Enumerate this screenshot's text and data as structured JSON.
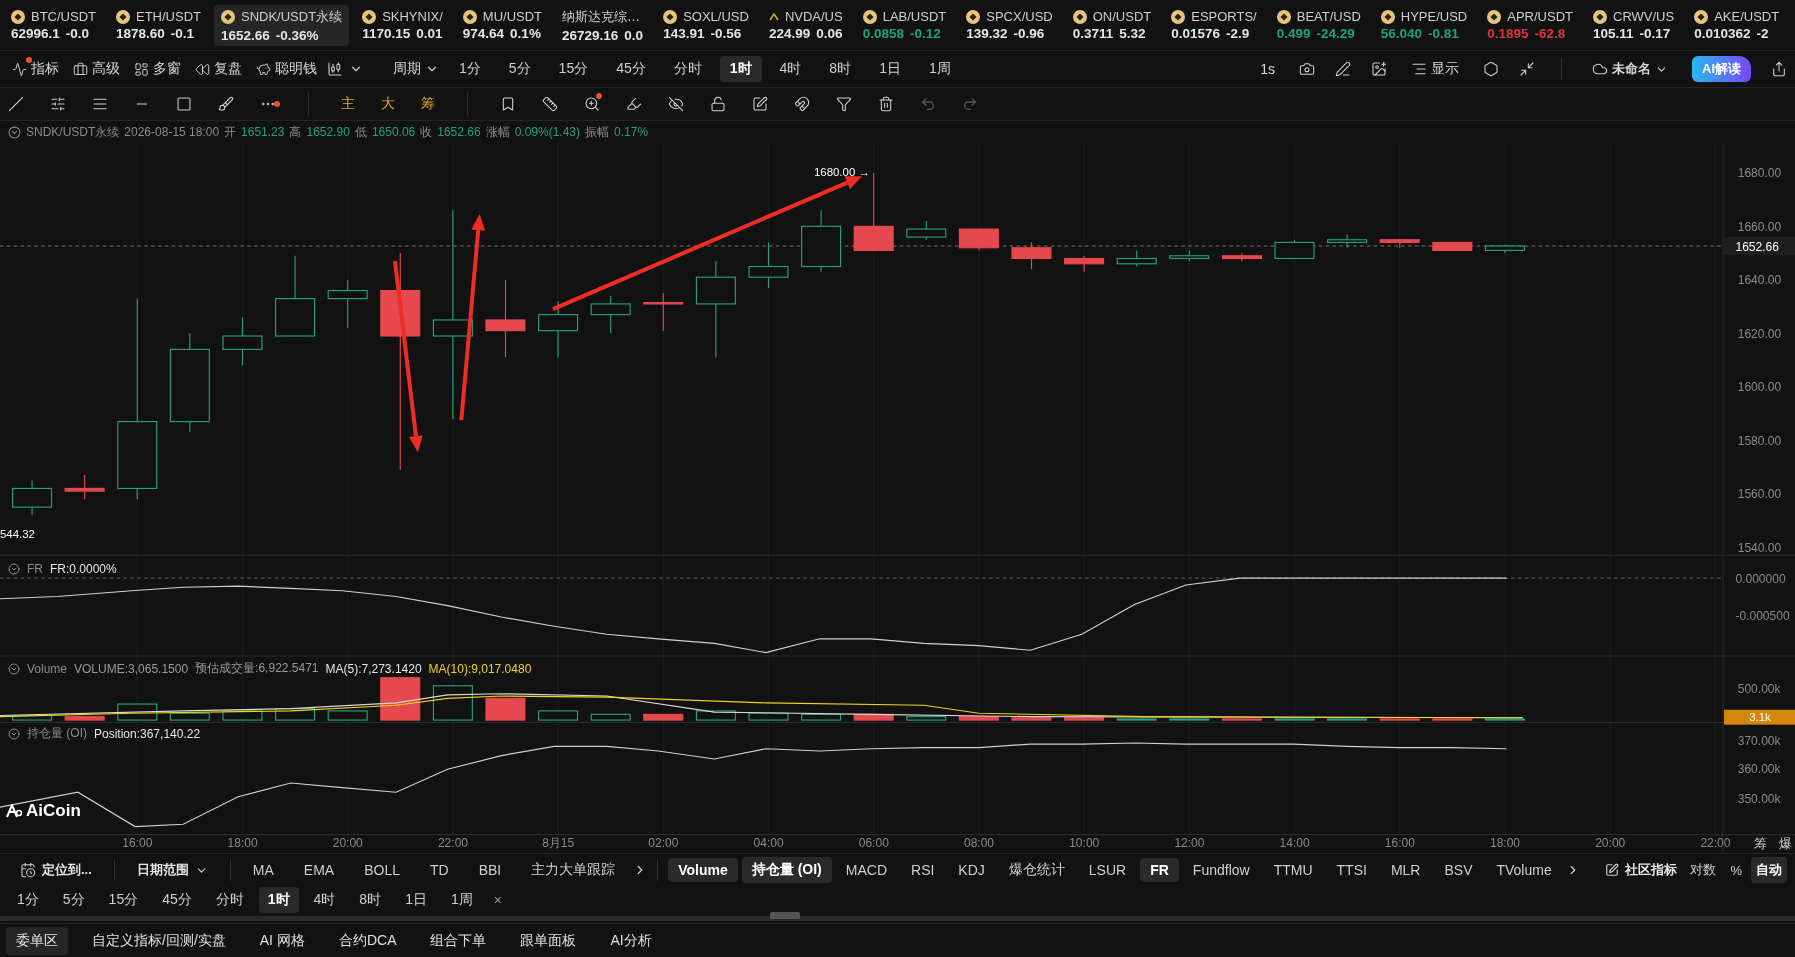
{
  "tickers": [
    {
      "kind": "coin",
      "symbol": "BTC/USDT",
      "price": "62996.1",
      "change": "-0.0",
      "color": "#e6e6e6",
      "selected": false
    },
    {
      "kind": "coin",
      "symbol": "ETH/USDT",
      "price": "1878.60",
      "change": "-0.1",
      "color": "#e6e6e6",
      "selected": false
    },
    {
      "kind": "coin",
      "symbol": "SNDK/USDT永续",
      "price": "1652.66",
      "change": "-0.36%",
      "color": "#e6e6e6",
      "selected": true
    },
    {
      "kind": "coin",
      "symbol": "SKHYNIX/",
      "price": "1170.15",
      "change": "0.01",
      "color": "#e6e6e6",
      "selected": false
    },
    {
      "kind": "coin",
      "symbol": "MU/USDT",
      "price": "974.64",
      "change": "0.1%",
      "color": "#e6e6e6",
      "selected": false
    },
    {
      "kind": "none",
      "symbol": "纳斯达克综…",
      "price": "26729.16",
      "change": "0.0",
      "color": "#e6e6e6",
      "selected": false
    },
    {
      "kind": "coin",
      "symbol": "SOXL/USD",
      "price": "143.91",
      "change": "-0.56",
      "color": "#e6e6e6",
      "selected": false
    },
    {
      "kind": "mark",
      "symbol": "NVDA/US",
      "price": "224.99",
      "change": "0.06",
      "color": "#e6e6e6",
      "selected": false
    },
    {
      "kind": "coin",
      "symbol": "LAB/USDT",
      "price": "0.0858",
      "change": "-0.12",
      "color": "#1fa37a",
      "selected": false
    },
    {
      "kind": "coin",
      "symbol": "SPCX/USD",
      "price": "139.32",
      "change": "-0.96",
      "color": "#e6e6e6",
      "selected": false
    },
    {
      "kind": "coin",
      "symbol": "ON/USDT",
      "price": "0.3711",
      "change": "5.32",
      "color": "#e6e6e6",
      "selected": false
    },
    {
      "kind": "coin",
      "symbol": "ESPORTS/",
      "price": "0.01576",
      "change": "-2.9",
      "color": "#e6e6e6",
      "selected": false
    },
    {
      "kind": "coin",
      "symbol": "BEAT/USD",
      "price": "0.499",
      "change": "-24.29",
      "color": "#1fa37a",
      "selected": false
    },
    {
      "kind": "coin",
      "symbol": "HYPE/USD",
      "price": "56.040",
      "change": "-0.81",
      "color": "#1fa37a",
      "selected": false
    },
    {
      "kind": "coin",
      "symbol": "APR/USDT",
      "price": "0.1895",
      "change": "-62.8",
      "color": "#d8373d",
      "selected": false
    },
    {
      "kind": "coin",
      "symbol": "CRWV/US",
      "price": "105.11",
      "change": "-0.17",
      "color": "#e6e6e6",
      "selected": false
    },
    {
      "kind": "coin",
      "symbol": "AKE/USDT",
      "price": "0.010362",
      "change": "-2",
      "color": "#e6e6e6",
      "selected": false
    }
  ],
  "toolbar": {
    "tools": [
      {
        "kind": "indicator",
        "label": "指标",
        "notify": true
      },
      {
        "kind": "advanced",
        "label": "高级",
        "notify": false
      },
      {
        "kind": "windows",
        "label": "多窗",
        "notify": false
      },
      {
        "kind": "replay",
        "label": "复盘",
        "notify": false
      },
      {
        "kind": "smart",
        "label": "聪明钱",
        "notify": false
      }
    ],
    "period_menu": "周期",
    "periods": [
      {
        "label": "1分",
        "selected": false
      },
      {
        "label": "5分",
        "selected": false
      },
      {
        "label": "15分",
        "selected": false
      },
      {
        "label": "45分",
        "selected": false
      },
      {
        "label": "分时",
        "selected": false
      },
      {
        "label": "1时",
        "selected": true
      },
      {
        "label": "4时",
        "selected": false
      },
      {
        "label": "8时",
        "selected": false
      },
      {
        "label": "1日",
        "selected": false
      },
      {
        "label": "1周",
        "selected": false
      }
    ],
    "refresh": "1s",
    "display": "显示",
    "layout": "未命名",
    "ai": "AI解读"
  },
  "drawing_toolbar": {
    "more_notify": true,
    "zoom_notify": true,
    "layers": [
      "主",
      "大",
      "筹"
    ]
  },
  "info": {
    "symbol": "SNDK/USDT永续",
    "time": "2026-08-15 18:00",
    "fields": [
      {
        "label": "开",
        "value": "1651.23"
      },
      {
        "label": "高",
        "value": "1652.90"
      },
      {
        "label": "低",
        "value": "1650.06"
      },
      {
        "label": "收",
        "value": "1652.66"
      },
      {
        "label": "涨幅",
        "value": "0.09%(1.43)"
      },
      {
        "label": "振幅",
        "value": "0.17%"
      }
    ]
  },
  "chart": {
    "price_ticks": [
      "1680.00",
      "1660.00",
      "1640.00",
      "1620.00",
      "1600.00",
      "1580.00",
      "1560.00",
      "1540.00"
    ],
    "last_price": "1652.66",
    "high_marker": "1680.00 →",
    "low_marker": "544.32",
    "time_ticks": [
      "16:00",
      "18:00",
      "20:00",
      "22:00",
      "8月15",
      "02:00",
      "04:00",
      "06:00",
      "08:00",
      "10:00",
      "12:00",
      "14:00",
      "16:00",
      "18:00",
      "20:00",
      "22:00"
    ],
    "side_labels": [
      "筹",
      "爆"
    ]
  },
  "fr_pane": {
    "name": "FR",
    "readings": [
      {
        "text": "FR:0.0000%",
        "color": "#e6e6e6"
      }
    ],
    "ticks": [
      "0.000000",
      "-0.000500"
    ]
  },
  "volume_pane": {
    "name": "Volume",
    "readings": [
      {
        "text": "VOLUME:3,065.1500",
        "color": "#9a9a9a"
      },
      {
        "text": "预估成交量:6,922.5471",
        "color": "#9a9a9a"
      },
      {
        "text": "MA(5):7,273.1420",
        "color": "#e6e6e6"
      },
      {
        "text": "MA(10):9,017.0480",
        "color": "#f2d21b"
      }
    ],
    "ticks": [
      "500.00k"
    ],
    "last": "3.1k"
  },
  "oi_pane": {
    "name": "持仓量 (OI)",
    "readings": [
      {
        "text": "Position:367,140.22",
        "color": "#e6e6e6"
      }
    ],
    "ticks": [
      "370.00k",
      "360.00k",
      "350.00k"
    ]
  },
  "logo": "AiCoin",
  "indicator_bar": {
    "locate": "定位到...",
    "date_range": "日期范围",
    "main": [
      "MA",
      "EMA",
      "BOLL",
      "TD",
      "BBI",
      "主力大单跟踪"
    ],
    "sub": [
      {
        "label": "Volume",
        "selected": true
      },
      {
        "label": "持仓量 (OI)",
        "selected": true
      },
      {
        "label": "MACD",
        "selected": false
      },
      {
        "label": "RSI",
        "selected": false
      },
      {
        "label": "KDJ",
        "selected": false
      },
      {
        "label": "爆仓统计",
        "selected": false
      },
      {
        "label": "LSUR",
        "selected": false
      },
      {
        "label": "FR",
        "selected": true
      },
      {
        "label": "Fundflow",
        "selected": false
      },
      {
        "label": "TTMU",
        "selected": false
      },
      {
        "label": "TTSI",
        "selected": false
      },
      {
        "label": "MLR",
        "selected": false
      },
      {
        "label": "BSV",
        "selected": false
      },
      {
        "label": "TVolume",
        "selected": false
      }
    ],
    "community": "社区指标",
    "scale": [
      {
        "label": "对数",
        "selected": false
      },
      {
        "label": "%",
        "selected": false
      },
      {
        "label": "自动",
        "selected": true
      }
    ]
  },
  "period_bar": {
    "periods": [
      {
        "label": "1分",
        "selected": false
      },
      {
        "label": "5分",
        "selected": false
      },
      {
        "label": "15分",
        "selected": false
      },
      {
        "label": "45分",
        "selected": false
      },
      {
        "label": "分时",
        "selected": false
      },
      {
        "label": "1时",
        "selected": true
      },
      {
        "label": "4时",
        "selected": false
      },
      {
        "label": "8时",
        "selected": false
      },
      {
        "label": "1日",
        "selected": false
      },
      {
        "label": "1周",
        "selected": false
      }
    ],
    "close": "×"
  },
  "bottom_tabs": [
    {
      "label": "委单区",
      "selected": true
    },
    {
      "label": "自定义指标/回测/实盘",
      "selected": false
    },
    {
      "label": "AI 网格",
      "selected": false
    },
    {
      "label": "合约DCA",
      "selected": false
    },
    {
      "label": "组合下单",
      "selected": false
    },
    {
      "label": "跟单面板",
      "selected": false
    },
    {
      "label": "AI分析",
      "selected": false
    }
  ]
}
